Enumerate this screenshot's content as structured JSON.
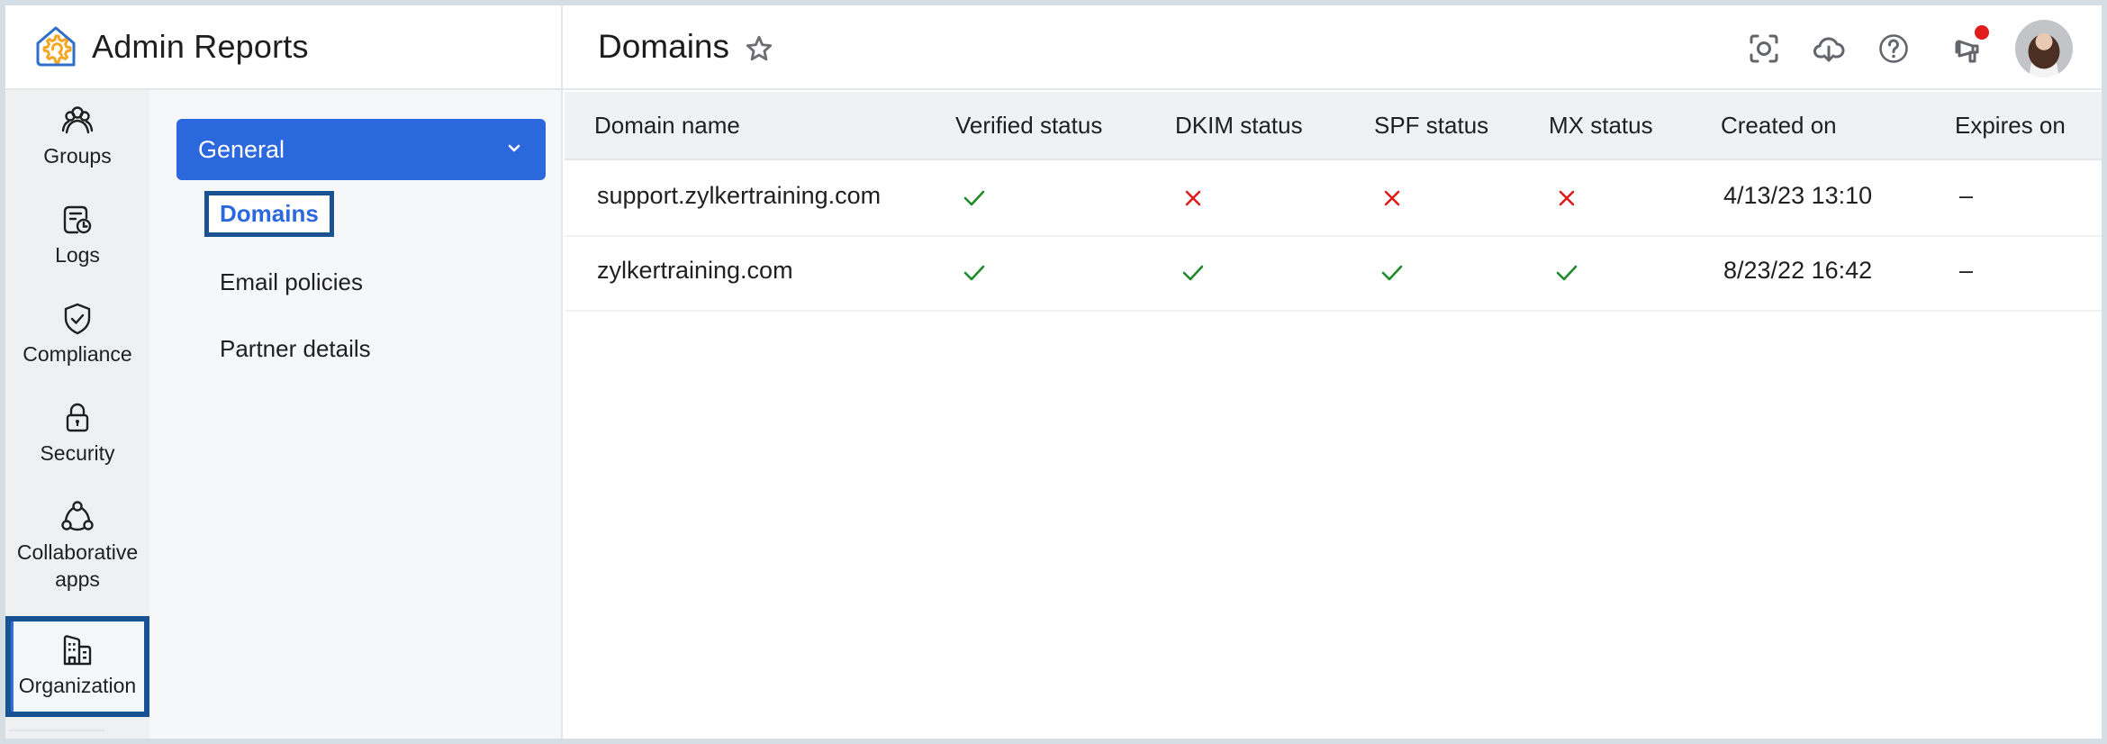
{
  "app": {
    "title": "Admin Reports",
    "logo_icon": "admin-settings-house-icon"
  },
  "header": {
    "page_title": "Domains",
    "favorite_icon": "star-icon",
    "actions": [
      {
        "name": "screenshot",
        "icon": "screen-capture-icon"
      },
      {
        "name": "download",
        "icon": "cloud-download-icon"
      },
      {
        "name": "help",
        "icon": "help-circle-icon"
      },
      {
        "name": "announcements",
        "icon": "megaphone-icon",
        "has_notification": true
      }
    ],
    "avatar": "user-avatar"
  },
  "rail": {
    "items": [
      {
        "label": "Groups",
        "icon": "groups-icon"
      },
      {
        "label": "Logs",
        "icon": "logs-icon"
      },
      {
        "label": "Compliance",
        "icon": "shield-check-icon"
      },
      {
        "label": "Security",
        "icon": "lock-icon"
      },
      {
        "label": "Collaborative apps",
        "label_line1": "Collaborative",
        "label_line2": "apps",
        "icon": "collaboration-icon"
      },
      {
        "label": "Organization",
        "icon": "building-icon",
        "active": true
      }
    ]
  },
  "submenu": {
    "section": {
      "label": "General",
      "expanded": true
    },
    "items": [
      {
        "label": "Domains",
        "active": true
      },
      {
        "label": "Email policies"
      },
      {
        "label": "Partner details"
      }
    ]
  },
  "table": {
    "columns": [
      "Domain name",
      "Verified status",
      "DKIM status",
      "SPF status",
      "MX status",
      "Created on",
      "Expires on"
    ],
    "rows": [
      {
        "domain": "support.zylkertraining.com",
        "verified": true,
        "dkim": false,
        "spf": false,
        "mx": false,
        "created": "4/13/23 13:10",
        "expires": "–"
      },
      {
        "domain": "zylkertraining.com",
        "verified": true,
        "dkim": true,
        "spf": true,
        "mx": true,
        "created": "8/23/22 16:42",
        "expires": "–"
      }
    ]
  },
  "colors": {
    "accent": "#2c68dd",
    "highlight_outline": "#1a5291",
    "success": "#1f8a2a",
    "error": "#e01c1c",
    "notification": "#e01c1c"
  }
}
